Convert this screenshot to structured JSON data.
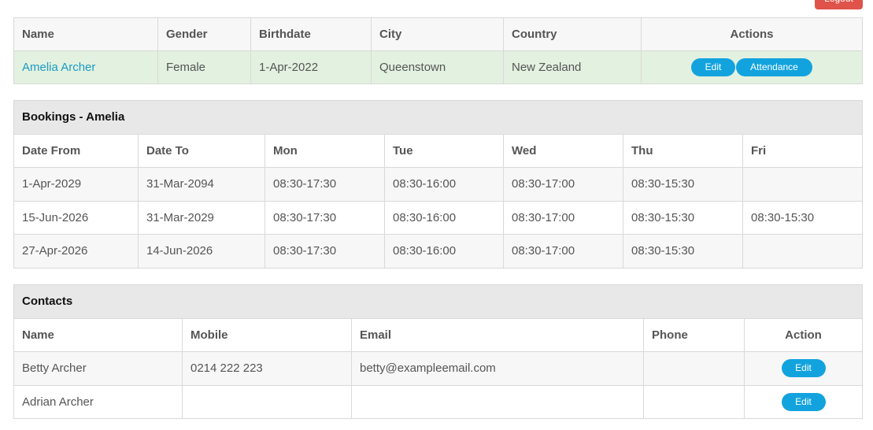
{
  "header": {
    "logout_label": "Logout"
  },
  "person": {
    "columns": [
      "Name",
      "Gender",
      "Birthdate",
      "City",
      "Country",
      "Actions"
    ],
    "row": {
      "name": "Amelia Archer",
      "gender": "Female",
      "birthdate": "1-Apr-2022",
      "city": "Queenstown",
      "country": "New Zealand"
    },
    "edit_label": "Edit",
    "attendance_label": "Attendance"
  },
  "bookings": {
    "title": "Bookings - Amelia",
    "columns": [
      "Date From",
      "Date To",
      "Mon",
      "Tue",
      "Wed",
      "Thu",
      "Fri"
    ],
    "rows": [
      [
        "1-Apr-2029",
        "31-Mar-2094",
        "08:30-17:30",
        "08:30-16:00",
        "08:30-17:00",
        "08:30-15:30",
        ""
      ],
      [
        "15-Jun-2026",
        "31-Mar-2029",
        "08:30-17:30",
        "08:30-16:00",
        "08:30-17:00",
        "08:30-15:30",
        "08:30-15:30"
      ],
      [
        "27-Apr-2026",
        "14-Jun-2026",
        "08:30-17:30",
        "08:30-16:00",
        "08:30-17:00",
        "08:30-15:30",
        ""
      ]
    ]
  },
  "contacts": {
    "title": "Contacts",
    "columns": [
      "Name",
      "Mobile",
      "Email",
      "Phone",
      "Action"
    ],
    "rows": [
      {
        "name": "Betty Archer",
        "mobile": "0214 222 223",
        "email": "betty@exampleemail.com",
        "phone": ""
      },
      {
        "name": "Adrian Archer",
        "mobile": "",
        "email": "",
        "phone": ""
      }
    ],
    "edit_label": "Edit"
  }
}
